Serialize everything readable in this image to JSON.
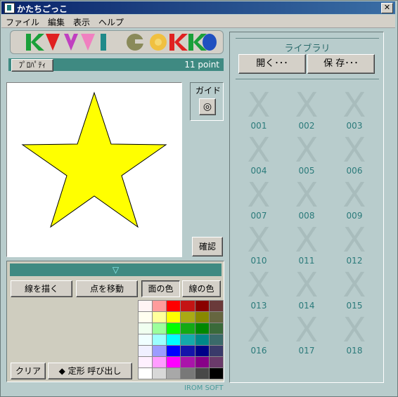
{
  "window": {
    "title": "かたちごっこ",
    "close_glyph": "✕"
  },
  "menu": [
    "ファイル",
    "編集",
    "表示",
    "ヘルプ"
  ],
  "logo": {
    "letters": [
      "K",
      "A",
      "V",
      "A",
      "T",
      "I",
      "G",
      "O",
      "K",
      "K",
      "O"
    ]
  },
  "properties": {
    "button_label": "ﾌﾟﾛﾊﾟﾃｨ",
    "point_text": "11 point"
  },
  "guide": {
    "label": "ガイド",
    "icon": "target-icon",
    "glyph": "◎"
  },
  "confirm_label": "確認",
  "tools": {
    "draw_line": "線を描く",
    "move_point": "点を移動",
    "face_color": "面の色",
    "line_color": "線の色",
    "clear": "クリア",
    "template": "◆ 定形 呼び出し",
    "collapse_glyph": "▽"
  },
  "star": {
    "fill": "#ffff00",
    "stroke": "#000000"
  },
  "palette": [
    [
      "#fff4f4",
      "#ff9c9c",
      "#ff0000",
      "#c41414",
      "#8a0000",
      "#6a3a3a"
    ],
    [
      "#fffff0",
      "#ffff9c",
      "#ffff00",
      "#aaaa14",
      "#888800",
      "#666640"
    ],
    [
      "#f0fff0",
      "#9cff9c",
      "#00ff00",
      "#14aa14",
      "#008800",
      "#3a6a3a"
    ],
    [
      "#f0ffff",
      "#9cffff",
      "#00ffff",
      "#14aaaa",
      "#008888",
      "#3a6a6a"
    ],
    [
      "#f0f0ff",
      "#9c9cff",
      "#0000ff",
      "#1414aa",
      "#000088",
      "#3a3a6a"
    ],
    [
      "#fff0ff",
      "#ff9cff",
      "#ff00ff",
      "#aa14aa",
      "#880088",
      "#6a3a6a"
    ],
    [
      "#ffffff",
      "#d8d8d8",
      "#a8a8a8",
      "#787878",
      "#484848",
      "#000000"
    ]
  ],
  "library": {
    "title": "ライブラリ",
    "open_label": "開く･･･",
    "save_label": "保 存･･･",
    "items": [
      "001",
      "002",
      "003",
      "004",
      "005",
      "006",
      "007",
      "008",
      "009",
      "010",
      "011",
      "012",
      "013",
      "014",
      "015",
      "016",
      "017",
      "018"
    ],
    "empty_glyph": "X"
  },
  "footer": "IROM SOFT"
}
